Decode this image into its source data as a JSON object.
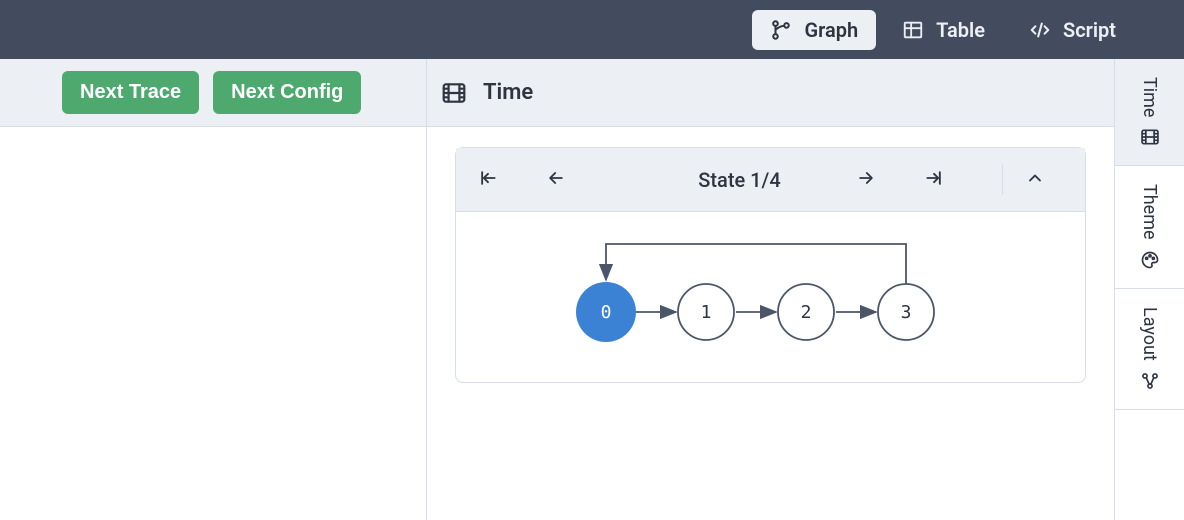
{
  "topbar": {
    "tabs": [
      {
        "label": "Graph",
        "active": true
      },
      {
        "label": "Table",
        "active": false
      },
      {
        "label": "Script",
        "active": false
      }
    ]
  },
  "left": {
    "buttons": {
      "next_trace": "Next Trace",
      "next_config": "Next Config"
    }
  },
  "panel": {
    "title": "Time",
    "state_label": "State 1/4",
    "current_state": 1,
    "total_states": 4,
    "nodes": [
      {
        "label": "0",
        "active": true
      },
      {
        "label": "1",
        "active": false
      },
      {
        "label": "2",
        "active": false
      },
      {
        "label": "3",
        "active": false
      }
    ]
  },
  "sidebar": {
    "tabs": [
      {
        "label": "Time",
        "active": true
      },
      {
        "label": "Theme",
        "active": false
      },
      {
        "label": "Layout",
        "active": false
      }
    ]
  }
}
